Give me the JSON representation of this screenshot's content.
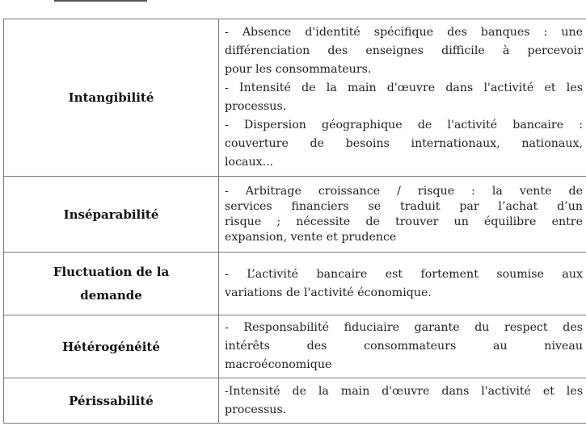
{
  "table": {
    "rows": [
      {
        "label": "Intangibilité",
        "lines": [
          "- Absence d'identité spécifique des banques : une",
          "différenciation des enseignes difficile à percevoir",
          "pour les consommateurs.",
          "- Intensité de la main d'œuvre dans l'activité et les",
          "processus.",
          "- Dispersion géographique de l'activité bancaire :",
          "couverture de besoins internationaux, nationaux,",
          "locaux..."
        ]
      },
      {
        "label": "Inséparabilité",
        "lines": [
          "- Arbitrage croissance / risque : la vente de",
          "services financiers se traduit par l’achat d’un",
          "risque ; nécessite de trouver un équilibre entre",
          "expansion, vente et prudence"
        ]
      },
      {
        "label_lines": [
          "Fluctuation de la",
          "demande"
        ],
        "lines": [
          "- L’activité bancaire est fortement soumise aux",
          "variations de l'activité économique."
        ]
      },
      {
        "label": "Hétérogénéité",
        "lines": [
          "- Responsabilité fiduciaire garante du respect des",
          "intérêts des consommateurs au niveau",
          "macroéconomique"
        ]
      },
      {
        "label": "Périssabilité",
        "lines": [
          "-Intensité de la main d'œuvre dans l'activité et les",
          "processus."
        ]
      }
    ]
  }
}
